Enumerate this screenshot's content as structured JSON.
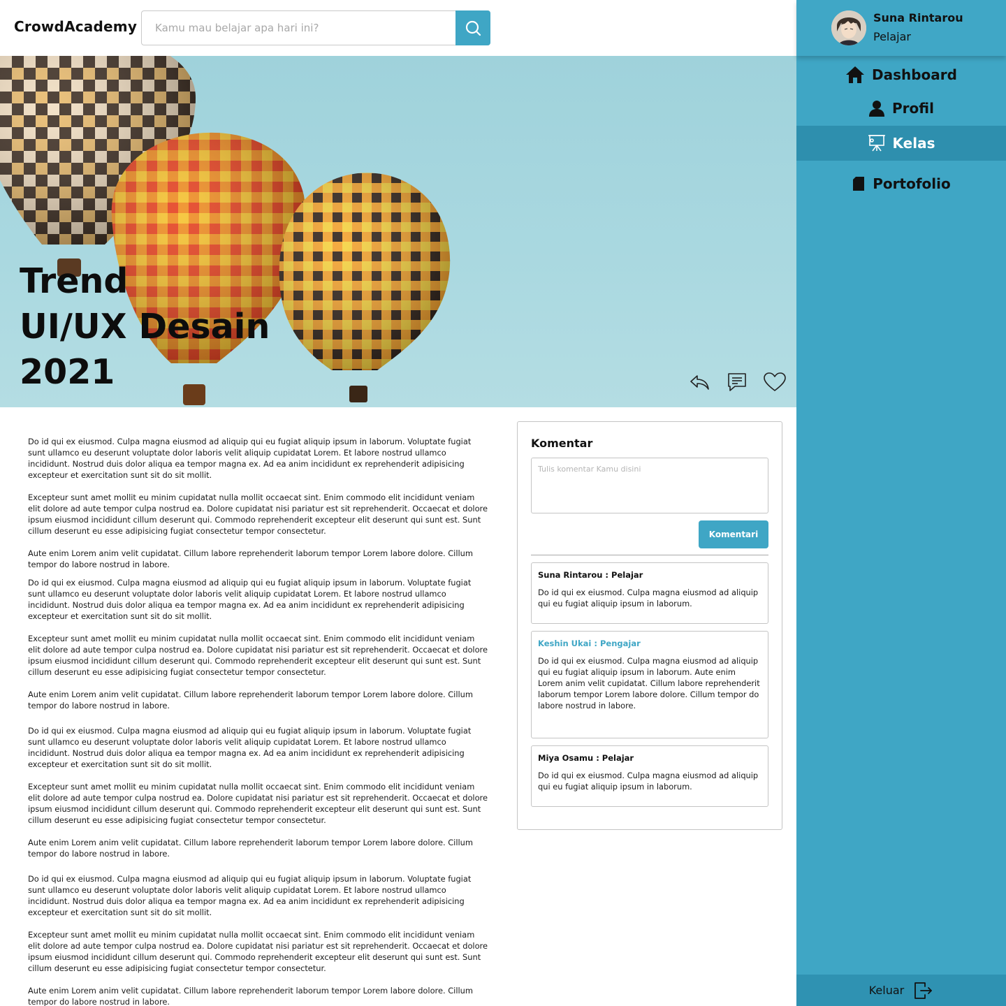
{
  "app": {
    "brand": "CrowdAcademy"
  },
  "search": {
    "placeholder": "Kamu mau belajar apa hari ini?"
  },
  "user": {
    "name": "Suna Rintarou",
    "role": "Pelajar"
  },
  "sidebar": {
    "items": [
      {
        "label": "Dashboard",
        "icon": "home-icon"
      },
      {
        "label": "Profil",
        "icon": "user-icon"
      },
      {
        "label": "Kelas",
        "icon": "presentation-board-icon",
        "active": true
      },
      {
        "label": "Portofolio",
        "icon": "folder-icon"
      }
    ],
    "logout_label": "Keluar"
  },
  "hero": {
    "title_lines": [
      "Trend",
      "UI/UX Desain",
      "2021"
    ],
    "actions": [
      "share-icon",
      "comment-icon",
      "heart-icon"
    ]
  },
  "article": {
    "paragraphs": [
      "Do id qui ex eiusmod. Culpa magna eiusmod ad aliquip qui eu fugiat aliquip ipsum in laborum. Voluptate fugiat sunt ullamco eu deserunt voluptate dolor laboris velit aliquip cupidatat Lorem. Et labore nostrud ullamco incididunt. Nostrud duis dolor aliqua ea tempor magna ex. Ad ea anim incididunt ex reprehenderit adipisicing excepteur et exercitation sunt sit do sit mollit.",
      "Excepteur sunt amet mollit eu minim cupidatat nulla mollit occaecat sint. Enim commodo elit incididunt veniam elit dolore ad aute tempor culpa nostrud ea. Dolore cupidatat nisi pariatur est sit reprehenderit. Occaecat et dolore ipsum eiusmod incididunt cillum deserunt qui. Commodo reprehenderit excepteur elit deserunt qui sunt est. Sunt cillum deserunt eu esse adipisicing fugiat consectetur tempor consectetur.",
      "Aute enim Lorem anim velit cupidatat. Cillum labore reprehenderit laborum tempor Lorem labore dolore. Cillum tempor do labore nostrud in labore.",
      "Do id qui ex eiusmod. Culpa magna eiusmod ad aliquip qui eu fugiat aliquip ipsum in laborum. Voluptate fugiat sunt ullamco eu deserunt voluptate dolor laboris velit aliquip cupidatat Lorem. Et labore nostrud ullamco incididunt. Nostrud duis dolor aliqua ea tempor magna ex. Ad ea anim incididunt ex reprehenderit adipisicing excepteur et exercitation sunt sit do sit mollit.",
      "Excepteur sunt amet mollit eu minim cupidatat nulla mollit occaecat sint. Enim commodo elit incididunt veniam elit dolore ad aute tempor culpa nostrud ea. Dolore cupidatat nisi pariatur est sit reprehenderit. Occaecat et dolore ipsum eiusmod incididunt cillum deserunt qui. Commodo reprehenderit excepteur elit deserunt qui sunt est. Sunt cillum deserunt eu esse adipisicing fugiat consectetur tempor consectetur.",
      "Aute enim Lorem anim velit cupidatat. Cillum labore reprehenderit laborum tempor Lorem labore dolore. Cillum tempor do labore nostrud in labore.",
      "Do id qui ex eiusmod. Culpa magna eiusmod ad aliquip qui eu fugiat aliquip ipsum in laborum. Voluptate fugiat sunt ullamco eu deserunt voluptate dolor laboris velit aliquip cupidatat Lorem. Et labore nostrud ullamco incididunt. Nostrud duis dolor aliqua ea tempor magna ex. Ad ea anim incididunt ex reprehenderit adipisicing excepteur et exercitation sunt sit do sit mollit.",
      "Excepteur sunt amet mollit eu minim cupidatat nulla mollit occaecat sint. Enim commodo elit incididunt veniam elit dolore ad aute tempor culpa nostrud ea. Dolore cupidatat nisi pariatur est sit reprehenderit. Occaecat et dolore ipsum eiusmod incididunt cillum deserunt qui. Commodo reprehenderit excepteur elit deserunt qui sunt est. Sunt cillum deserunt eu esse adipisicing fugiat consectetur tempor consectetur.",
      "Aute enim Lorem anim velit cupidatat. Cillum labore reprehenderit laborum tempor Lorem labore dolore. Cillum tempor do labore nostrud in labore.",
      "Do id qui ex eiusmod. Culpa magna eiusmod ad aliquip qui eu fugiat aliquip ipsum in laborum. Voluptate fugiat sunt ullamco eu deserunt voluptate dolor laboris velit aliquip cupidatat Lorem. Et labore nostrud ullamco incididunt. Nostrud duis dolor aliqua ea tempor magna ex. Ad ea anim incididunt ex reprehenderit adipisicing excepteur et exercitation sunt sit do sit mollit.",
      "Excepteur sunt amet mollit eu minim cupidatat nulla mollit occaecat sint. Enim commodo elit incididunt veniam elit dolore ad aute tempor culpa nostrud ea. Dolore cupidatat nisi pariatur est sit reprehenderit. Occaecat et dolore ipsum eiusmod incididunt cillum deserunt qui. Commodo reprehenderit excepteur elit deserunt qui sunt est. Sunt cillum deserunt eu esse adipisicing fugiat consectetur tempor consectetur.",
      "Aute enim Lorem anim velit cupidatat. Cillum labore reprehenderit laborum tempor Lorem labore dolore. Cillum tempor do labore nostrud in labore."
    ]
  },
  "comments": {
    "title": "Komentar",
    "input_placeholder": "Tulis komentar Kamu disini",
    "submit_label": "Komentari",
    "items": [
      {
        "author": "Suna Rintarou : Pelajar",
        "text": "Do id qui ex eiusmod. Culpa magna eiusmod ad aliquip qui eu fugiat aliquip ipsum in laborum."
      },
      {
        "author": "Keshin Ukai : Pengajar",
        "text": "Do id qui ex eiusmod. Culpa magna eiusmod ad aliquip qui eu fugiat aliquip ipsum in laborum. Aute enim Lorem anim velit cupidatat. Cillum labore reprehenderit laborum tempor Lorem labore dolore. Cillum tempor do labore nostrud in labore."
      },
      {
        "author": "Miya Osamu : Pelajar",
        "text": "Do id qui ex eiusmod. Culpa magna eiusmod ad aliquip qui eu fugiat aliquip ipsum in laborum."
      }
    ]
  },
  "colors": {
    "accent": "#3fa6c5",
    "accent_dark": "#2e8fae",
    "teacher_name": "#3fa6c5"
  }
}
